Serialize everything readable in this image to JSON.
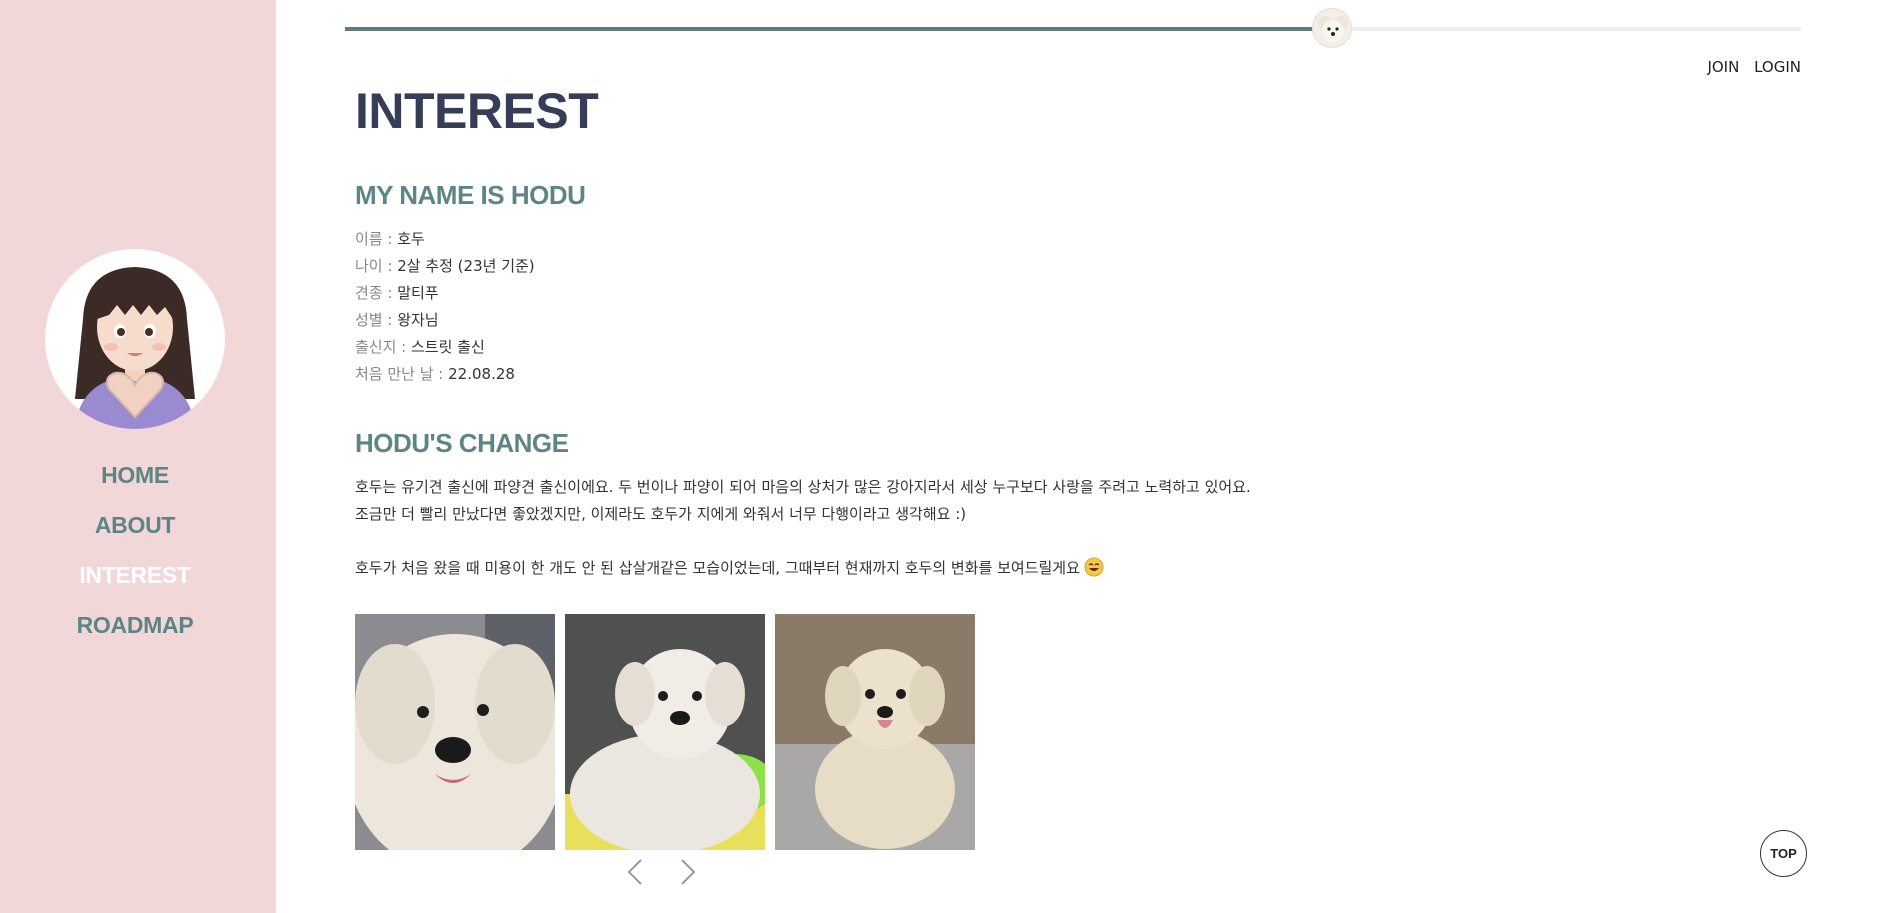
{
  "sidebar": {
    "nav": [
      {
        "label": "HOME"
      },
      {
        "label": "ABOUT"
      },
      {
        "label": "INTEREST"
      },
      {
        "label": "ROADMAP"
      }
    ],
    "active_index": 2
  },
  "progress": {
    "fraction": 0.678
  },
  "auth": {
    "join": "JOIN",
    "login": "LOGIN"
  },
  "main": {
    "title": "INTEREST",
    "profile": {
      "heading": "MY NAME IS HODU",
      "items": [
        {
          "label": "이름 : ",
          "value": "호두"
        },
        {
          "label": "나이 : ",
          "value": "2살 추정 (23년 기준)"
        },
        {
          "label": "견종 : ",
          "value": "말티푸"
        },
        {
          "label": "성별 : ",
          "value": "왕자님"
        },
        {
          "label": "출신지 : ",
          "value": "스트릿 출신"
        },
        {
          "label": "처음 만난 날 : ",
          "value": "22.08.28"
        }
      ]
    },
    "change": {
      "heading": "HODU'S CHANGE",
      "line1": "호두는 유기견 출신에 파양견 출신이에요. 두 번이나 파양이 되어 마음의 상처가 많은 강아지라서 세상 누구보다 사랑을 주려고 노력하고 있어요.",
      "line2": "조금만 더 빨리 만났다면 좋았겠지만, 이제라도 호두가 지에게 와줘서 너무 다행이라고 생각해요 :)",
      "line3": "호두가 처음 왔을 때 미용이 한 개도 안 된 삽살개같은 모습이었는데, 그때부터 현재까지 호두의 변화를 보여드릴게요"
    },
    "gallery": {
      "photos": [
        {
          "name": "hodu-photo-closeup"
        },
        {
          "name": "hodu-photo-lying"
        },
        {
          "name": "hodu-photo-sitting"
        }
      ]
    },
    "top_button": "TOP"
  },
  "colors": {
    "sidebar_bg": "#f2d7d8",
    "nav_text": "#5e8585",
    "nav_active": "#ffffff",
    "title": "#363d57",
    "progress": "#5e7b7e"
  }
}
